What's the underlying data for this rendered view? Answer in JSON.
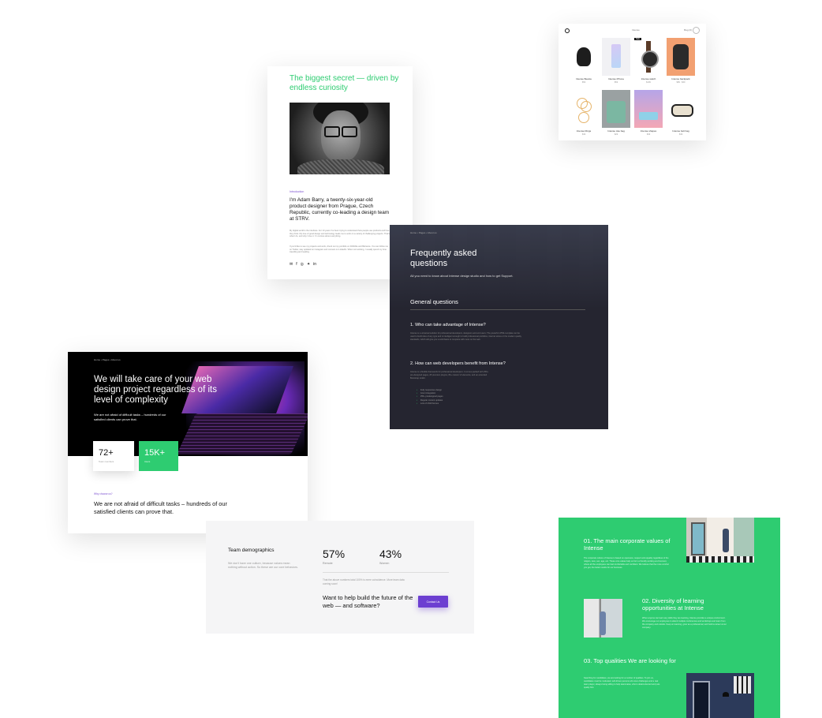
{
  "shop": {
    "nav": "Intense",
    "cart": "Bag (0)",
    "products": [
      {
        "name": "Intense Beanie",
        "price": "$59",
        "icon": "beanie-icon"
      },
      {
        "name": "Intense iPhone",
        "price": "$59",
        "icon": "phone-case-icon"
      },
      {
        "name": "Intense watch",
        "price": "$199",
        "icon": "watch-icon",
        "badge": "Sale"
      },
      {
        "name": "Intense backpack",
        "price": "$89 · $69",
        "icon": "backpack-icon"
      },
      {
        "name": "Intense Rings",
        "price": "$49",
        "icon": "rings-icon"
      },
      {
        "name": "Intense tote bag",
        "price": "$29",
        "icon": "tote-bag-icon"
      },
      {
        "name": "Intense shapes",
        "price": "$39",
        "icon": "shapes-icon"
      },
      {
        "name": "Intense belt bag",
        "price": "$49",
        "icon": "belt-bag-icon"
      }
    ]
  },
  "about": {
    "title": "The biggest secret — driven by endless curiosity",
    "kicker": "Introduction",
    "intro": "I'm Adam Barry, a twenty-six-year-old product designer from Prague, Czech Republic, currently co-leading a design team at STRV.",
    "body1": "My digital world is the interface. For 10 years I've been trying to understand how people use products and how they think. My love of good design and technology leads me to work on a variety of challenging projects. That's what I do, and why I love it. I'm curious about everything.",
    "body2": "If you'd like to see my projects and work, check out my portfolio on Dribbble and Behance. You can follow me on Twitter, stay updated on Instagram and connect on LinkedIn. When not working, I usually spend my time travelling and reading.",
    "socials": [
      "✉",
      "f",
      "◎",
      "✦",
      "in"
    ]
  },
  "faq": {
    "breadcrumb": "Home  •  Pages  •  About us",
    "title": "Frequently asked questions",
    "subtitle": "All you need to know about Intense design studio and how to get Support.",
    "section": "General questions",
    "q1": "1.  Who can take advantage of Intense?",
    "a1": "Intense is a universal solution for professional developers, designers and end users. The powerful HTML template can be used to build sites of any type and is intelligent enough to build professional portfolios, internet stores or the modern quality standards, which will give you a solid basis to complete with more on the web.",
    "q2": "2.  How can web developers benefit from Intense?",
    "a2": "Intense is a flexible framework for professional developers. It comes packed with 250+ pre-designed pages, 25 premium plugins, 80+ custom UI elements, and an extended Bootstrap toolkit.",
    "list": [
      "Fully responsive design",
      "Grunt integration",
      "250+ predesigned pages",
      "Regular content updates",
      "Lots of child themes"
    ]
  },
  "hero": {
    "breadcrumb": "Home  •  Pages  •  About us",
    "title": "We will take care of your web design project regardless of its level of complexity",
    "subtitle": "We are not afraid of difficult tasks – hundreds of our satisfied clients can prove that.",
    "stat1_num": "72+",
    "stat1_label": "Team members",
    "stat2_num": "15K+",
    "stat2_label": "Users",
    "why": "Why choose us?",
    "bottom": "We are not afraid of difficult tasks – hundreds of our satisfied clients can prove that."
  },
  "demo": {
    "title": "Team demographics",
    "desc": "We don't have one culture, because values mean nothing without action. So these are our core behaviors.",
    "p1": "57%",
    "l1": "Remote",
    "p2": "43%",
    "l2": "Women",
    "note": "That the above numbers total 100% is mere coincidence. More team data coming soon!",
    "cta": "Want to help build the future of the web — and software?",
    "button": "Contact Us"
  },
  "values": {
    "t1": "01.  The main corporate values of Intense",
    "b1": "The corporate culture of Intense is based on openness, respect and equality regardless of the religion, race, sex, age, etc. These core values help us form a friendly working environment, where all the employees can feel comfortable and confident. We believe that the more comfort you get, the better results for our business.",
    "t2": "02.  Diversity of learning opportunities at Intense",
    "b2": "When anyone can learn any skills they are learning, Intense provides a unique environment. We encourage our employees to attend multiple conferences and workshops and learn from the company and outside. Keep on learning, grow as a professional, and build a career at our company.",
    "t3": "03.  Top qualities We are looking for",
    "b3": "Searching for candidates, we are looking for a number of qualities. To join us, candidates must be motivated, self-driven persons who love challenges and a real team player, always being willing to help teammates, who is detail-oriented and puts quality first."
  },
  "colors": {
    "accent_green": "#2ecc71",
    "accent_purple": "#6c3fd1",
    "faq_bg": "#252530"
  }
}
